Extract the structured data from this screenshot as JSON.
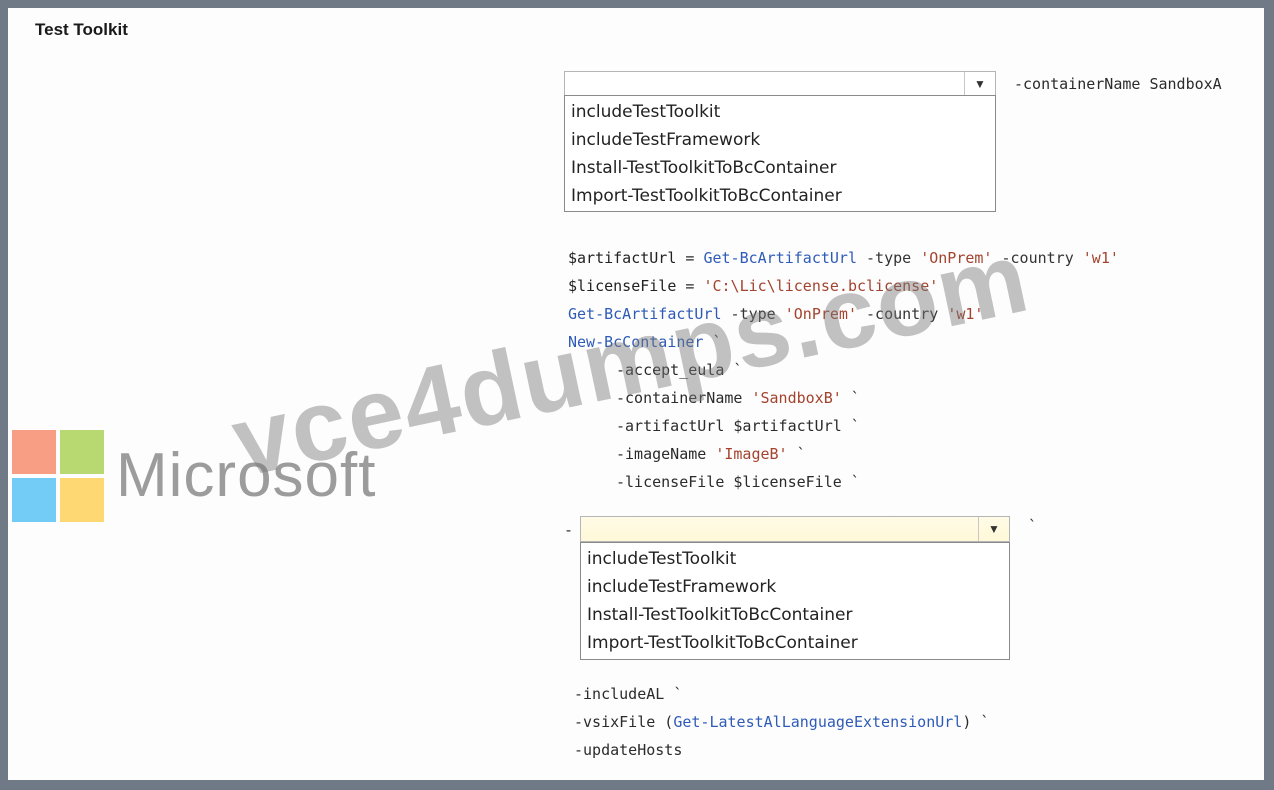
{
  "title": "Test Toolkit",
  "dropdown1": {
    "suffix_param": "-containerName",
    "suffix_value": "SandboxA",
    "options": [
      "includeTestToolkit",
      "includeTestFramework",
      "Install-TestToolkitToBcContainer",
      "Import-TestToolkitToBcContainer"
    ]
  },
  "code": {
    "l1_var": "$artifactUrl",
    "l1_eq": " = ",
    "l1_cmd": "Get-BcArtifactUrl",
    "l1_p1": " -type ",
    "l1_s1": "'OnPrem'",
    "l1_p2": " -country ",
    "l1_s2": "'w1'",
    "l2_var": "$licenseFile",
    "l2_eq": " = ",
    "l2_s": "'C:\\Lic\\license.bclicense'",
    "l3_cmd": "Get-BcArtifactUrl",
    "l3_p1": " -type ",
    "l3_s1": "'OnPrem'",
    "l3_p2": " -country ",
    "l3_s2": "'w1'",
    "l4_cmd": "New-BcContainer",
    "l4_tick": " `",
    "l5": "-accept_eula `",
    "l6_p": "-containerName ",
    "l6_s": "'SandboxB'",
    "l6_t": " `",
    "l7": "-artifactUrl $artifactUrl `",
    "l8_p": "-imageName ",
    "l8_s": "'ImageB'",
    "l8_t": " `",
    "l9": "-licenseFile $licenseFile `",
    "dash": "-",
    "tick": "`",
    "b1": "-includeAL `",
    "b2_p": "-vsixFile (",
    "b2_cmd": "Get-LatestAlLanguageExtensionUrl",
    "b2_t": ") `",
    "b3": "-updateHosts"
  },
  "dropdown2": {
    "options": [
      "includeTestToolkit",
      "includeTestFramework",
      "Install-TestToolkitToBcContainer",
      "Import-TestToolkitToBcContainer"
    ]
  },
  "logo_text": "Microsoft",
  "watermark": "vce4dumps.com",
  "colors": {
    "logo_red": "#f25022",
    "logo_green": "#7fba00",
    "logo_blue": "#00a4ef",
    "logo_yellow": "#ffb900"
  }
}
